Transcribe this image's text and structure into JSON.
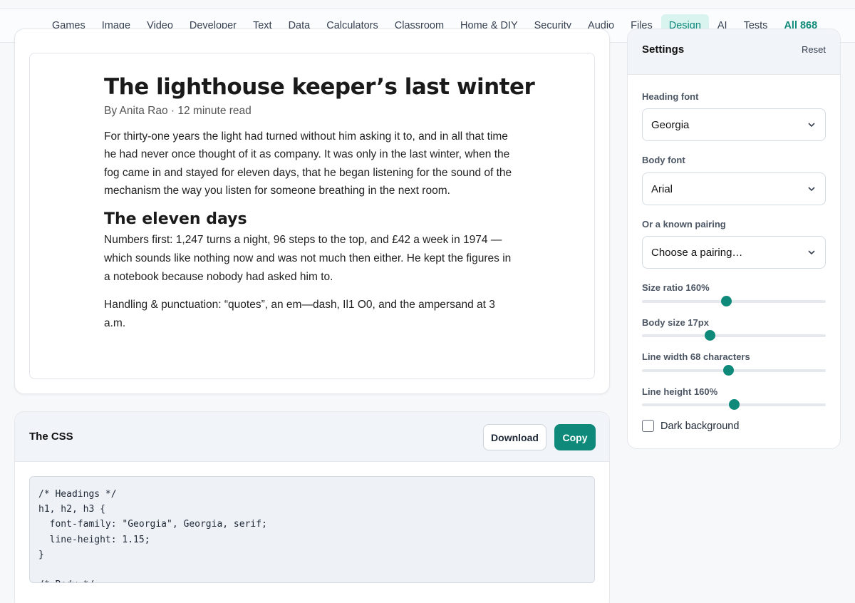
{
  "nav": {
    "items": [
      "Games",
      "Image",
      "Video",
      "Developer",
      "Text",
      "Data",
      "Calculators",
      "Classroom",
      "Home & DIY",
      "Security",
      "Audio",
      "Files",
      "Design",
      "AI",
      "Tests",
      "All 868"
    ],
    "active": "Design"
  },
  "article": {
    "title": "The lighthouse keeper’s last winter",
    "byline": "By Anita Rao · 12 minute read",
    "p1": "For thirty-one years the light had turned without him asking it to, and in all that time he had never once thought of it as company. It was only in the last winter, when the fog came in and stayed for eleven days, that he began listening for the sound of the mechanism the way you listen for someone breathing in the next room.",
    "h2": "The eleven days",
    "p2": "Numbers first: 1,247 turns a night, 96 steps to the top, and £42 a week in 1974 — which sounds like nothing now and was not much then either. He kept the figures in a notebook because nobody had asked him to.",
    "p3": "Handling & punctuation: “quotes”, an em—dash, Il1 O0, and the ampersand at 3 a.m."
  },
  "css_panel": {
    "title": "The CSS",
    "download_label": "Download",
    "copy_label": "Copy",
    "code": "/* Headings */\nh1, h2, h3 {\n  font-family: \"Georgia\", Georgia, serif;\n  line-height: 1.15;\n}\n\n/* Body */"
  },
  "settings": {
    "title": "Settings",
    "reset_label": "Reset",
    "heading_font_label": "Heading font",
    "heading_font_value": "Georgia",
    "body_font_label": "Body font",
    "body_font_value": "Arial",
    "pairing_label": "Or a known pairing",
    "pairing_value": "Choose a pairing…",
    "size_ratio_label": "Size ratio 160%",
    "size_ratio_fraction": 0.46,
    "body_size_label": "Body size 17px",
    "body_size_fraction": 0.37,
    "line_width_label": "Line width 68 characters",
    "line_width_fraction": 0.47,
    "line_height_label": "Line height 160%",
    "line_height_fraction": 0.5,
    "dark_bg_label": "Dark background",
    "dark_bg_checked": false
  },
  "colors": {
    "accent": "#0f8a7a",
    "active_tab_bg": "#d9f3ee"
  }
}
